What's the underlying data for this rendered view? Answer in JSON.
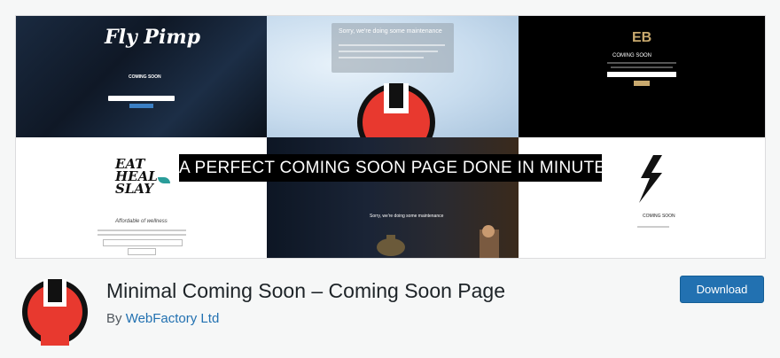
{
  "banner": {
    "tagline": "A PERFECT COMING SOON PAGE DONE IN MINUTES",
    "panel1": {
      "logo_text": "Fly Pimp",
      "heading": "COMING SOON"
    },
    "panel2": {
      "heading": "Sorry, we're doing some maintenance"
    },
    "panel3": {
      "logo_text": "EB",
      "heading": "COMING SOON"
    },
    "panel4": {
      "logo_text": "EAT HEAL SLAY",
      "subheading": "Affordable of wellness"
    },
    "panel5": {
      "heading": "Sorry, we're doing some maintenance"
    },
    "panel6": {
      "heading": "COMING SOON"
    }
  },
  "plugin": {
    "title": "Minimal Coming Soon – Coming Soon Page",
    "author_prefix": "By",
    "author_name": "WebFactory Ltd",
    "download_label": "Download",
    "icon": "wrench-logo-icon"
  },
  "colors": {
    "accent": "#2271b1",
    "logo_red": "#e8392f",
    "page_bg": "#f6f7f7"
  }
}
